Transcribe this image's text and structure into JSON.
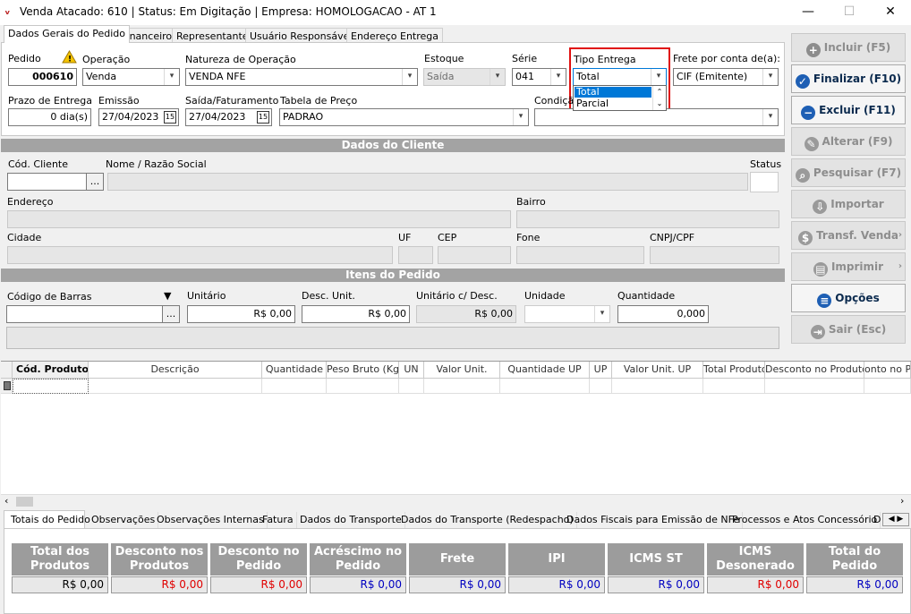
{
  "window": {
    "title": "Venda Atacado: 610 | Status: Em Digitação | Empresa: HOMOLOGACAO - AT 1",
    "minimize": "—",
    "maximize": "☐",
    "close": "✕"
  },
  "tabs": [
    "Dados Gerais do Pedido",
    "Financeiro",
    "Representante",
    "Usuário Responsável",
    "Endereço Entrega"
  ],
  "pedido": {
    "pedido_label": "Pedido",
    "pedido_value": "000610",
    "operacao_label": "Operação",
    "operacao_value": "Venda",
    "natureza_label": "Natureza de Operação",
    "natureza_value": "VENDA NFE",
    "estoque_label": "Estoque",
    "estoque_value": "Saída",
    "serie_label": "Série",
    "serie_value": "041",
    "tipo_entrega_label": "Tipo Entrega",
    "tipo_entrega_value": "Total",
    "tipo_entrega_options": [
      "Total",
      "Parcial"
    ],
    "frete_label": "Frete por conta de(a):",
    "frete_value": "CIF (Emitente)",
    "prazo_label": "Prazo de Entrega",
    "prazo_value": "0 dia(s)",
    "emissao_label": "Emissão",
    "emissao_value": "27/04/2023",
    "saida_label": "Saída/Faturamento",
    "saida_value": "27/04/2023",
    "tabela_label": "Tabela de Preço",
    "tabela_value": "PADRAO",
    "condicao_label": "Condiçã",
    "calendar_icon_text": "15"
  },
  "cliente": {
    "section_title": "Dados do Cliente",
    "cod_label": "Cód. Cliente",
    "nome_label": "Nome / Razão Social",
    "status_label": "Status",
    "endereco_label": "Endereço",
    "bairro_label": "Bairro",
    "cidade_label": "Cidade",
    "uf_label": "UF",
    "cep_label": "CEP",
    "fone_label": "Fone",
    "cnpj_label": "CNPJ/CPF",
    "lookup_button": "..."
  },
  "itens": {
    "section_title": "Itens do Pedido",
    "codbarras_label": "Código de Barras",
    "unitario_label": "Unitário",
    "unitario_value": "R$ 0,00",
    "desc_label": "Desc. Unit.",
    "desc_value": "R$ 0,00",
    "unit_desc_label": "Unitário c/ Desc.",
    "unit_desc_value": "R$ 0,00",
    "unidade_label": "Unidade",
    "quantidade_label": "Quantidade",
    "quantidade_value": "0,000"
  },
  "grid": {
    "columns": [
      "Cód. Produto",
      "Descrição",
      "Quantidade",
      "Peso Bruto (Kg)",
      "UN",
      "Valor Unit.",
      "Quantidade UP",
      "UP",
      "Valor Unit. UP",
      "Total Produto",
      "Desconto no Produto",
      "onto no P"
    ]
  },
  "bottom_tabs": [
    "Totais do Pedido",
    "Observações",
    "Observações Internas",
    "Fatura",
    "Dados do Transporte",
    "Dados do Transporte (Redespacho)",
    "Dados Fiscais para Emissão de NFe",
    "Processos e Atos Concessório",
    "D"
  ],
  "totais": [
    {
      "label": "Total dos Produtos",
      "value": "R$ 0,00",
      "color": "#000000"
    },
    {
      "label": "Desconto nos Produtos",
      "value": "R$ 0,00",
      "color": "#e00000"
    },
    {
      "label": "Desconto no Pedido",
      "value": "R$ 0,00",
      "color": "#e00000"
    },
    {
      "label": "Acréscimo no Pedido",
      "value": "R$ 0,00",
      "color": "#0000c0"
    },
    {
      "label": "Frete",
      "value": "R$ 0,00",
      "color": "#0000c0"
    },
    {
      "label": "IPI",
      "value": "R$ 0,00",
      "color": "#0000c0"
    },
    {
      "label": "ICMS ST",
      "value": "R$ 0,00",
      "color": "#0000c0"
    },
    {
      "label": "ICMS Desonerado",
      "value": "R$ 0,00",
      "color": "#e00000"
    },
    {
      "label": "Total do Pedido",
      "value": "R$ 0,00",
      "color": "#0000c0"
    }
  ],
  "actions": [
    {
      "label": "Incluir (F5)",
      "enabled": false,
      "icon": "plus-circle-icon",
      "arrow": ""
    },
    {
      "label": "Finalizar (F10)",
      "enabled": true,
      "icon": "check-circle-icon",
      "arrow": ""
    },
    {
      "label": "Excluir (F11)",
      "enabled": true,
      "icon": "minus-circle-icon",
      "arrow": ""
    },
    {
      "label": "Alterar (F9)",
      "enabled": false,
      "icon": "edit-icon",
      "arrow": ""
    },
    {
      "label": "Pesquisar (F7)",
      "enabled": false,
      "icon": "search-icon",
      "arrow": ""
    },
    {
      "label": "Importar",
      "enabled": false,
      "icon": "import-icon",
      "arrow": ""
    },
    {
      "label": "Transf. Venda",
      "enabled": false,
      "icon": "transfer-icon",
      "arrow": "›"
    },
    {
      "label": "Imprimir",
      "enabled": false,
      "icon": "print-icon",
      "arrow": "›"
    },
    {
      "label": "Opções",
      "enabled": true,
      "icon": "menu-icon",
      "arrow": ""
    },
    {
      "label": "Sair (Esc)",
      "enabled": false,
      "icon": "exit-icon",
      "arrow": ""
    }
  ]
}
